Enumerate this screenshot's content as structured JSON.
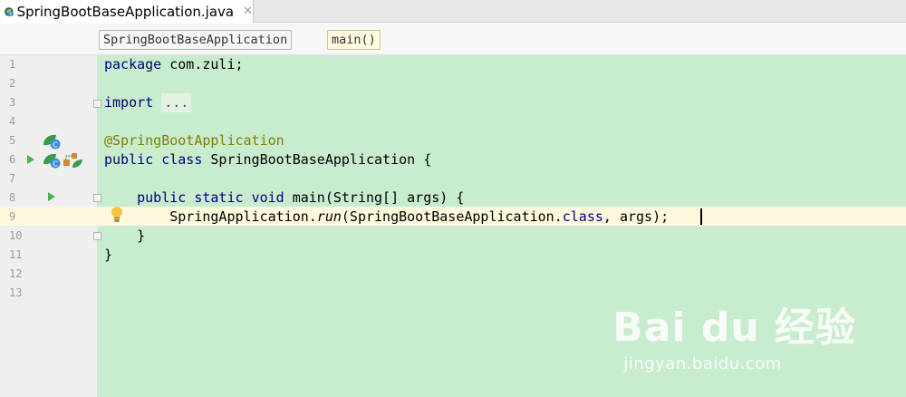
{
  "tab": {
    "label": "SpringBootBaseApplication.java",
    "close": "✕",
    "icon": "spring-java-file-icon"
  },
  "breadcrumbs": [
    "SpringBootBaseApplication",
    "main()"
  ],
  "line_numbers": [
    "1",
    "2",
    "3",
    "4",
    "5",
    "6",
    "7",
    "8",
    "9",
    "10",
    "11",
    "12",
    "13"
  ],
  "code": {
    "l1_kw": "package",
    "l1_rest": " com.zuli;",
    "l3_kw": "import",
    "l3_fold": "...",
    "l6_ann": "@SpringBootApplication",
    "l7_kw1": "public",
    "l7_kw2": "class",
    "l7_rest": " SpringBootBaseApplication {",
    "l9_indent": "    ",
    "l9_kw1": "public",
    "l9_kw2": "static",
    "l9_kw3": "void",
    "l9_rest": " main(String[] args) {",
    "l10_pre": "        SpringApplication.",
    "l10_it": "run",
    "l10_mid": "(SpringBootBaseApplication.",
    "l10_kw": "class",
    "l10_post": ", args);",
    "l11": "    }",
    "l12": "}"
  },
  "colors": {
    "code_bg": "#c8ecce",
    "keyword": "#000080",
    "annotation": "#808000",
    "current_line": "#fdf9dc"
  },
  "watermark": {
    "main": "Bai du 经验",
    "sub": "jingyan.baidu.com"
  }
}
